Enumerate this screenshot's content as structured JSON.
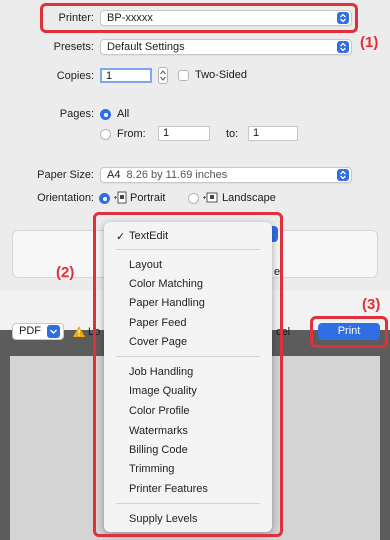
{
  "printer": {
    "label": "Printer:",
    "value": "BP-xxxxx"
  },
  "presets": {
    "label": "Presets:",
    "value": "Default Settings"
  },
  "copies": {
    "label": "Copies:",
    "value": "1",
    "two_sided_label": "Two-Sided"
  },
  "pages": {
    "label": "Pages:",
    "all_label": "All",
    "from_label": "From:",
    "from_value": "1",
    "to_label": "to:",
    "to_value": "1"
  },
  "paper_size": {
    "label": "Paper Size:",
    "value": "A4",
    "dimensions": "8.26 by 11.69 inches"
  },
  "orientation": {
    "label": "Orientation:",
    "portrait_label": "Portrait",
    "landscape_label": "Landscape"
  },
  "menu": {
    "checked_item": "TextEdit",
    "group1": [
      "Layout",
      "Color Matching",
      "Paper Handling",
      "Paper Feed",
      "Cover Page"
    ],
    "group2": [
      "Job Handling",
      "Image Quality",
      "Color Profile",
      "Watermarks",
      "Billing Code",
      "Trimming",
      "Printer Features"
    ],
    "group3": [
      "Supply Levels"
    ]
  },
  "footer": {
    "pdf_label": "PDF",
    "cancel_partial": "cel",
    "print_label": "Print",
    "behind_partial_left": "Lo",
    "behind_partial_right": "e"
  },
  "annotations": {
    "callout1": "(1)",
    "callout2": "(2)",
    "callout3": "(3)"
  },
  "colors": {
    "accent": "#2f6fe3",
    "callout": "#e0303c"
  }
}
